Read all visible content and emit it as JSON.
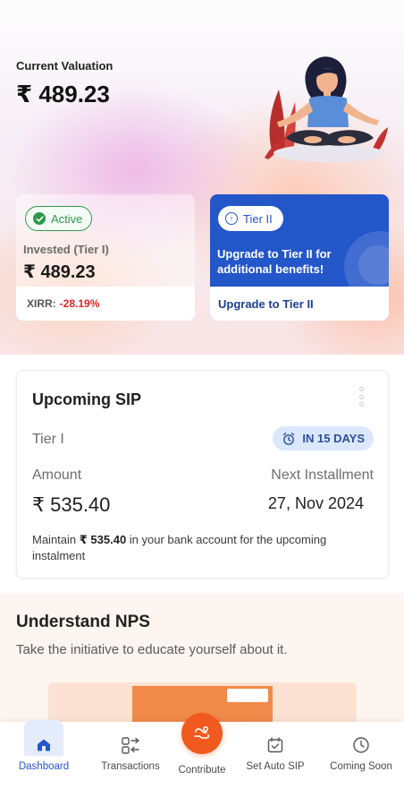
{
  "valuation": {
    "label": "Current Valuation",
    "amount": "₹ 489.23"
  },
  "tier1_card": {
    "status": "Active",
    "invested_label": "Invested (Tier I)",
    "invested_amount": "₹ 489.23",
    "xirr_label": "XIRR:",
    "xirr_value": "-28.19%"
  },
  "tier2_card": {
    "pill": "Tier II",
    "description": "Upgrade to Tier II for additional benefits!",
    "link": "Upgrade to Tier II"
  },
  "upcoming_sip": {
    "title": "Upcoming SIP",
    "tier": "Tier I",
    "due_badge": "IN 15 DAYS",
    "amount_label": "Amount",
    "amount_value": "₹ 535.40",
    "next_label": "Next Installment",
    "next_value": "27, Nov 2024",
    "maintain_prefix": "Maintain ",
    "maintain_amount": "₹ 535.40",
    "maintain_suffix": " in your bank account for the upcoming instalment"
  },
  "nps": {
    "title": "Understand NPS",
    "subtitle": "Take the initiative to educate yourself about it."
  },
  "bottom_nav": {
    "items": [
      {
        "label": "Dashboard",
        "icon": "home-icon"
      },
      {
        "label": "Transactions",
        "icon": "transactions-icon"
      },
      {
        "label": "Contribute",
        "icon": "contribute-icon"
      },
      {
        "label": "Set Auto SIP",
        "icon": "calendar-check-icon"
      },
      {
        "label": "Coming Soon",
        "icon": "clock-icon"
      }
    ]
  },
  "colors": {
    "primary_blue": "#2356c9",
    "active_green": "#2d9a4a",
    "negative_red": "#e02424",
    "accent_orange": "#f2591e"
  }
}
